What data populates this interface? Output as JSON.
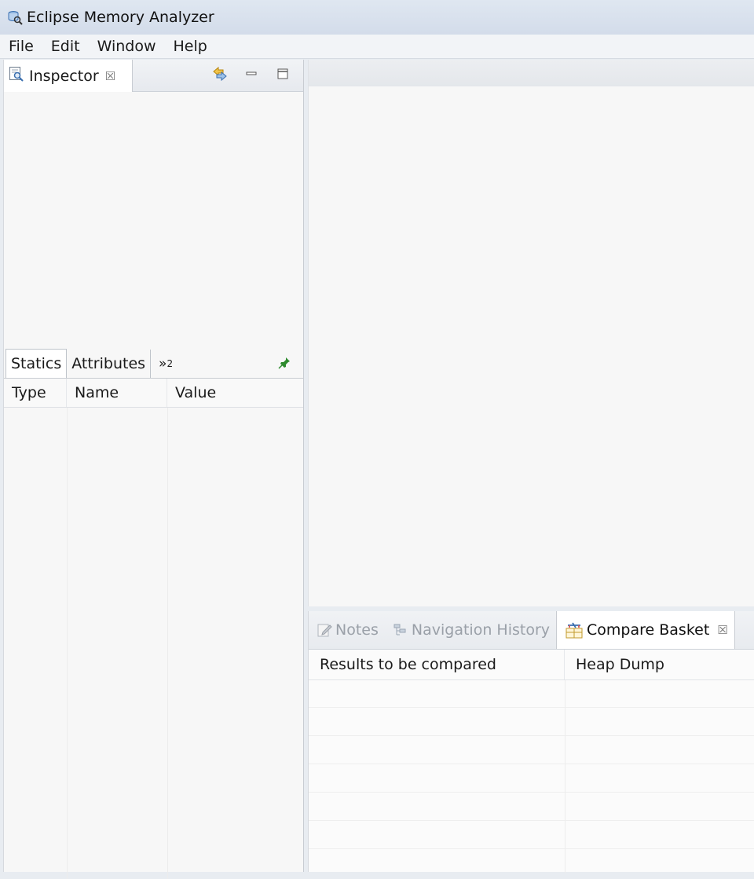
{
  "window": {
    "title": "Eclipse Memory Analyzer",
    "icon": "memory-analyzer-icon"
  },
  "menu": {
    "items": [
      "File",
      "Edit",
      "Window",
      "Help"
    ]
  },
  "inspector": {
    "tab_label": "Inspector",
    "tab_icon": "inspector-icon",
    "close_glyph": "☒",
    "toolbar_icons": [
      "sync-icon",
      "minimize-icon",
      "maximize-icon"
    ],
    "sub_tabs": [
      "Statics",
      "Attributes"
    ],
    "more_tabs_glyph": "»",
    "more_tabs_count": "2",
    "columns": [
      "Type",
      "Name",
      "Value"
    ]
  },
  "bottom": {
    "tabs": [
      {
        "label": "Notes",
        "icon": "notes-icon",
        "active": false
      },
      {
        "label": "Navigation History",
        "icon": "navigation-history-icon",
        "active": false
      },
      {
        "label": "Compare Basket",
        "icon": "compare-basket-icon",
        "active": true
      }
    ],
    "close_glyph": "☒",
    "columns": [
      "Results to be compared",
      "Heap Dump"
    ]
  },
  "colors": {
    "accent": "#3a6fb0",
    "inactive_tab_text": "#9aa0a8",
    "pin": "#2e8b2e"
  }
}
